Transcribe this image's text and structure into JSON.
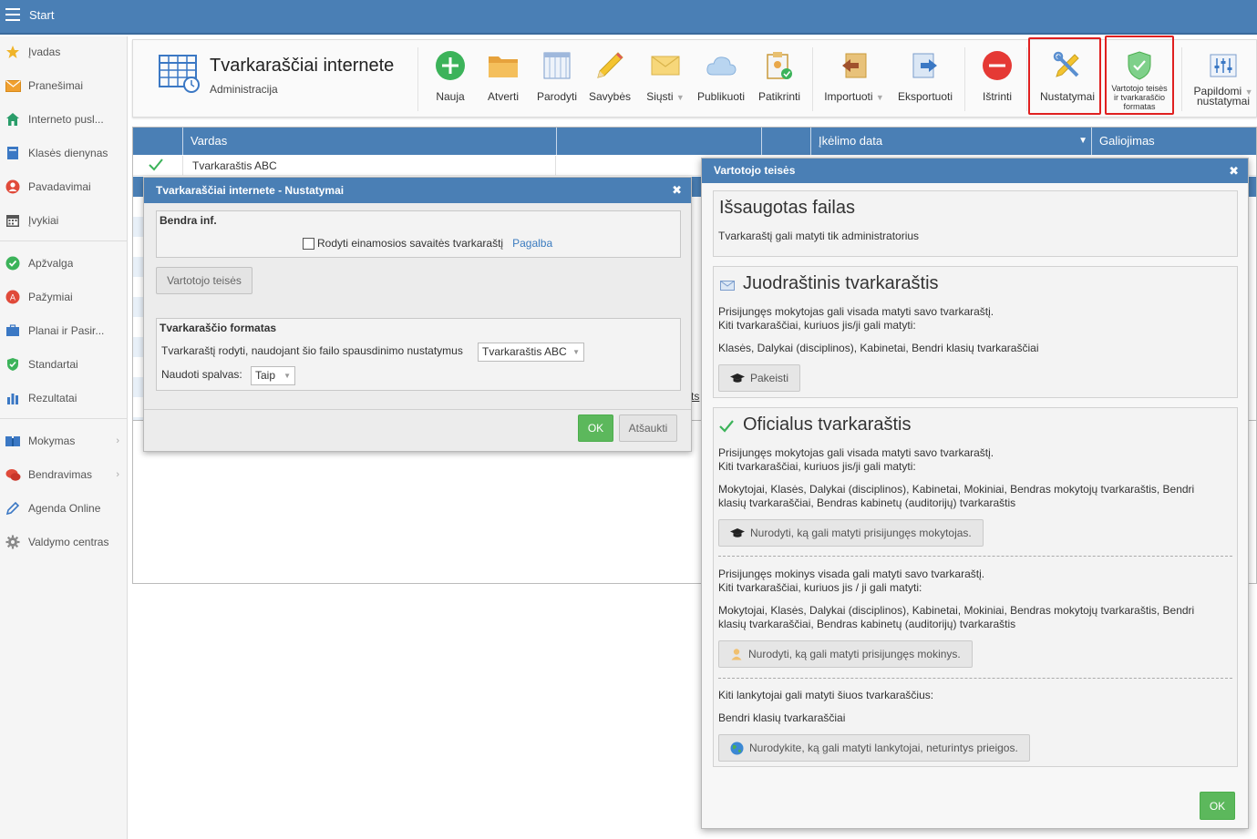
{
  "topbar": {
    "start_label": "Start"
  },
  "sidebar": {
    "items": [
      {
        "label": "Įvadas"
      },
      {
        "label": "Pranešimai"
      },
      {
        "label": "Interneto pusl..."
      },
      {
        "label": "Klasės dienynas"
      },
      {
        "label": "Pavadavimai"
      },
      {
        "label": "Įvykiai"
      },
      {
        "label": "Apžvalga"
      },
      {
        "label": "Pažymiai"
      },
      {
        "label": "Planai ir Pasir..."
      },
      {
        "label": "Standartai"
      },
      {
        "label": "Rezultatai"
      },
      {
        "label": "Mokymas"
      },
      {
        "label": "Bendravimas"
      },
      {
        "label": "Agenda Online"
      },
      {
        "label": "Valdymo centras"
      }
    ]
  },
  "app": {
    "title": "Tvarkaraščiai internete",
    "subtitle": "Administracija"
  },
  "toolbar": {
    "new": "Nauja",
    "open": "Atverti",
    "show": "Parodyti",
    "properties": "Savybės",
    "send": "Siųsti",
    "publish": "Publikuoti",
    "check": "Patikrinti",
    "import": "Importuoti",
    "export": "Eksportuoti",
    "delete": "Ištrinti",
    "settings": "Nustatymai",
    "rights_line1": "Vartotojo teisės",
    "rights_line2": "ir tvarkaraščio",
    "rights_line3": "formatas",
    "extra_line1": "Papildomi",
    "extra_line2": "nustatymai"
  },
  "grid": {
    "columns": [
      "Vardas",
      "Įkėlimo data",
      "Galiojimas"
    ],
    "rows": [
      {
        "name": "Tvarkaraštis ABC"
      }
    ],
    "partial_text": "ts"
  },
  "dialog_settings": {
    "title": "Tvarkaraščiai internete - Nustatymai",
    "general_legend": "Bendra inf.",
    "show_current_week_label": "Rodyti einamosios savaitės tvarkaraštį",
    "help_link": "Pagalba",
    "user_rights_button": "Vartotojo teisės",
    "format_legend": "Tvarkaraščio formatas",
    "format_label": "Tvarkaraštį rodyti, naudojant šio failo spausdinimo nustatymus",
    "format_value": "Tvarkaraštis ABC",
    "colors_label": "Naudoti spalvas:",
    "colors_value": "Taip",
    "ok": "OK",
    "cancel": "Atšaukti"
  },
  "dialog_rights": {
    "title": "Vartotojo teisės",
    "saved": {
      "title": "Išsaugotas failas",
      "text": "Tvarkaraštį gali matyti tik administratorius"
    },
    "draft": {
      "title": "Juodraštinis tvarkaraštis",
      "line1": "Prisijungęs mokytojas gali visada matyti savo tvarkaraštį.",
      "line2": "Kiti tvarkaraščiai, kuriuos jis/ji gali matyti:",
      "list": "Klasės, Dalykai (disciplinos), Kabinetai, Bendri klasių tvarkaraščiai",
      "button": "Pakeisti"
    },
    "official": {
      "title": "Oficialus tvarkaraštis",
      "teacher_line1": "Prisijungęs mokytojas gali visada matyti savo tvarkaraštį.",
      "teacher_line2": "Kiti tvarkaraščiai, kuriuos jis/ji gali matyti:",
      "teacher_list1": "Mokytojai, Klasės, Dalykai (disciplinos), Kabinetai, Mokiniai, Bendras mokytojų tvarkaraštis, Bendri",
      "teacher_list2": "klasių tvarkaraščiai, Bendras kabinetų (auditorijų) tvarkaraštis",
      "teacher_button": "Nurodyti, ką gali matyti prisijungęs mokytojas.",
      "student_line1": "Prisijungęs mokinys visada gali matyti savo tvarkaraštį.",
      "student_line2": "Kiti tvarkaraščiai, kuriuos jis / ji gali matyti:",
      "student_list1": "Mokytojai, Klasės, Dalykai (disciplinos), Kabinetai, Mokiniai, Bendras mokytojų tvarkaraštis, Bendri",
      "student_list2": "klasių tvarkaraščiai, Bendras kabinetų (auditorijų) tvarkaraštis",
      "student_button": "Nurodyti, ką gali matyti prisijungęs mokinys.",
      "visitor_line": "Kiti lankytojai gali matyti šiuos tvarkaraščius:",
      "visitor_list": "Bendri klasių tvarkaraščiai",
      "visitor_button": "Nurodykite, ką gali matyti lankytojai, neturintys prieigos."
    },
    "ok": "OK"
  },
  "colors": {
    "header_blue": "#4a7fb5",
    "green": "#5cb85c",
    "red_highlight": "#e02020"
  }
}
